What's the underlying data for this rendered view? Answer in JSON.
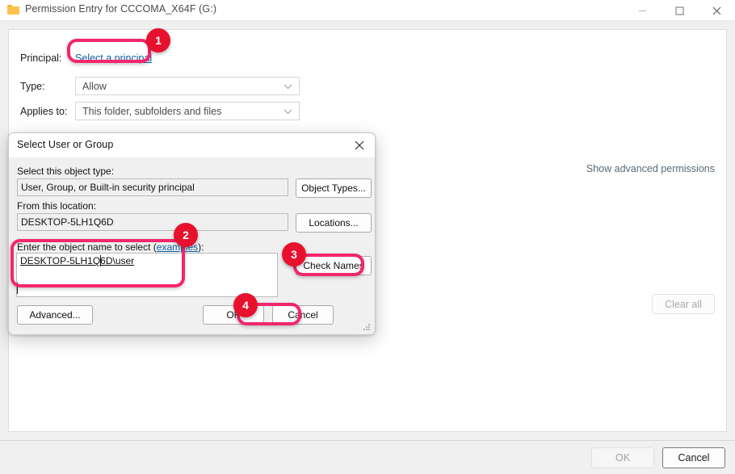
{
  "window": {
    "title": "Permission Entry for CCCOMA_X64F (G:)",
    "icon": "folder-icon",
    "controls": {
      "minimize": "minimize-icon",
      "maximize": "maximize-icon",
      "close": "close-icon"
    }
  },
  "main": {
    "fields": [
      {
        "label": "Principal:",
        "type": "link",
        "value": "Select a principal"
      },
      {
        "label": "Type:",
        "type": "combo",
        "value": "Allow"
      },
      {
        "label": "Applies to:",
        "type": "combo",
        "value": "This folder, subfolders and files"
      }
    ],
    "advanced_link": "Show advanced permissions",
    "clear_all": "Clear all"
  },
  "footer": {
    "ok": "OK",
    "cancel": "Cancel"
  },
  "dialog": {
    "title": "Select User or Group",
    "close": "close-icon",
    "object_type_label": "Select this object type:",
    "object_type_value": "User, Group, or Built-in security principal",
    "object_types_button": "Object Types...",
    "location_label": "From this location:",
    "location_value": "DESKTOP-5LH1Q6D",
    "locations_button": "Locations...",
    "object_name_label_before": "Enter the object name to select (",
    "object_name_label_link": "examples",
    "object_name_label_after": "):",
    "object_name_value": "DESKTOP-5LH1Q6D\\user",
    "check_names_button": "Check Names",
    "advanced_button": "Advanced...",
    "ok_button": "OK",
    "cancel_button": "Cancel"
  },
  "annotations": {
    "color": "#f2266e",
    "badge_color": "#e8112d",
    "steps": [
      {
        "n": "1",
        "target": "select-a-principal-link"
      },
      {
        "n": "2",
        "target": "object-name-input"
      },
      {
        "n": "3",
        "target": "check-names-button"
      },
      {
        "n": "4",
        "target": "dialog-ok-button"
      }
    ]
  }
}
